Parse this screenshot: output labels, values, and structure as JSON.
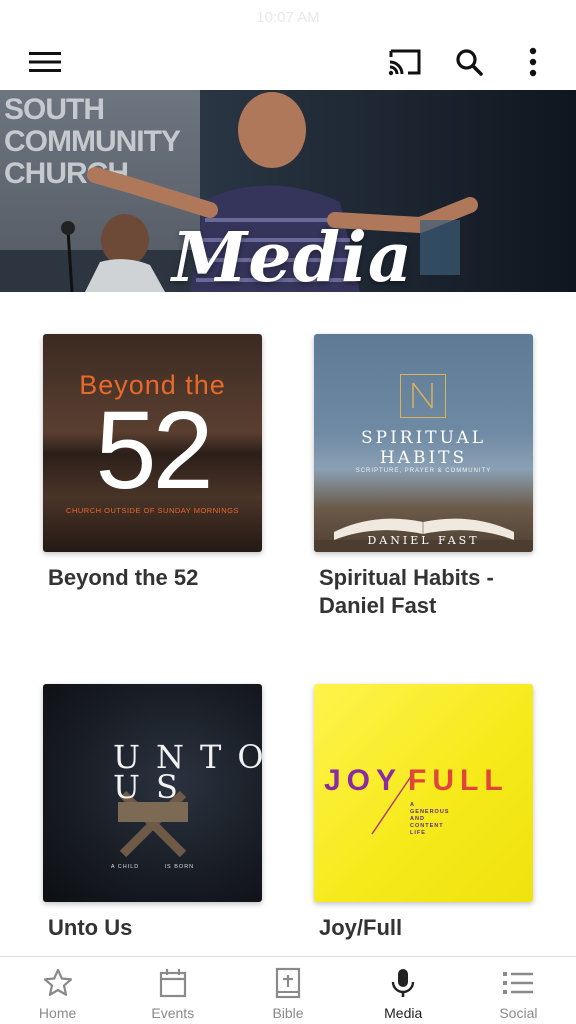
{
  "status_bar": {
    "time": "10:07 AM"
  },
  "toolbar": {
    "menu_icon": "hamburger-icon",
    "cast_icon": "cast-icon",
    "search_icon": "search-icon",
    "more_icon": "more-vertical-icon"
  },
  "hero": {
    "title": "Media",
    "background_text": "SOUTH\nCOMMUNITY\nCHURCH"
  },
  "media_items": [
    {
      "title": "Beyond the 52",
      "art": {
        "line1": "Beyond the",
        "number": "52",
        "subtitle": "CHURCH OUTSIDE OF SUNDAY MORNINGS"
      }
    },
    {
      "title": "Spiritual Habits - Daniel Fast",
      "art": {
        "heading": "SPIRITUAL\nHABITS",
        "tagline": "SCRIPTURE, PRAYER & COMMUNITY",
        "footer": "DANIEL FAST"
      }
    },
    {
      "title": "Unto Us",
      "art": {
        "letters": "UNTO\nUS",
        "caption": "A CHILD          IS BORN"
      }
    },
    {
      "title": "Joy/Full",
      "art": {
        "joy": "JOY",
        "full": "FULL",
        "small": "A\nGENEROUS\nAND\nCONTENT\nLIFE"
      }
    }
  ],
  "tabs": [
    {
      "label": "Home",
      "icon": "star-icon",
      "active": false
    },
    {
      "label": "Events",
      "icon": "calendar-icon",
      "active": false
    },
    {
      "label": "Bible",
      "icon": "bible-icon",
      "active": false
    },
    {
      "label": "Media",
      "icon": "microphone-icon",
      "active": true
    },
    {
      "label": "Social",
      "icon": "list-icon",
      "active": false
    }
  ],
  "colors": {
    "accent_orange": "#e8692a",
    "active_tab": "#222222",
    "inactive_tab": "#8a8a8a",
    "title_text": "#333333"
  }
}
